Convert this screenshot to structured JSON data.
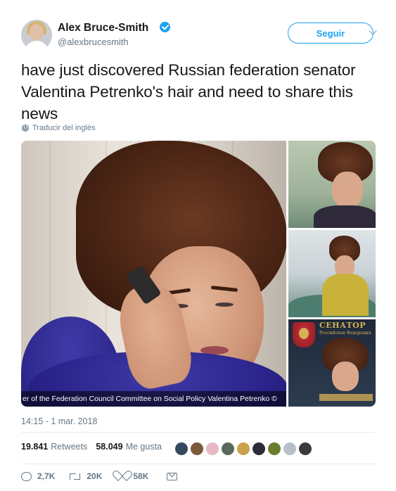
{
  "author": {
    "display_name": "Alex Bruce-Smith",
    "handle": "@alexbrucesmith",
    "verified": true,
    "avatar_icon": "profile-photo-icon"
  },
  "header": {
    "follow_label": "Seguir",
    "menu_icon": "chevron-down-icon"
  },
  "tweet": {
    "text": "have just discovered Russian federation senator Valentina Petrenko's hair and need to share this news",
    "translate_label": "Traducir del inglés",
    "translate_icon": "globe-icon"
  },
  "media": {
    "caption": "er of the Federation Council Committee on Social Policy Valentina Petrenko ©",
    "senate_banner": "СЕНАТОР",
    "senate_sub": "Российская Федерация",
    "photo_count": 4
  },
  "meta": {
    "timestamp": "14:15 - 1 mar. 2018"
  },
  "stats": {
    "retweets_count": "19.841",
    "retweets_label": "Retweets",
    "likes_count": "58.049",
    "likes_label": "Me gusta",
    "liker_colors": [
      "#34495e",
      "#7a5a3a",
      "#e6b8c4",
      "#5a6a5a",
      "#c9a24a",
      "#2d2d3a",
      "#6a7d2a",
      "#b7c0c8",
      "#3a3a3a"
    ]
  },
  "actions": {
    "reply_count": "2,7K",
    "retweet_count": "20K",
    "like_count": "58K",
    "icons": [
      "reply-icon",
      "retweet-icon",
      "like-icon",
      "message-icon"
    ]
  },
  "colors": {
    "accent": "#1da1f2",
    "secondary_text": "#657786",
    "primary_text": "#14171a",
    "divider": "#e6ecf0"
  }
}
